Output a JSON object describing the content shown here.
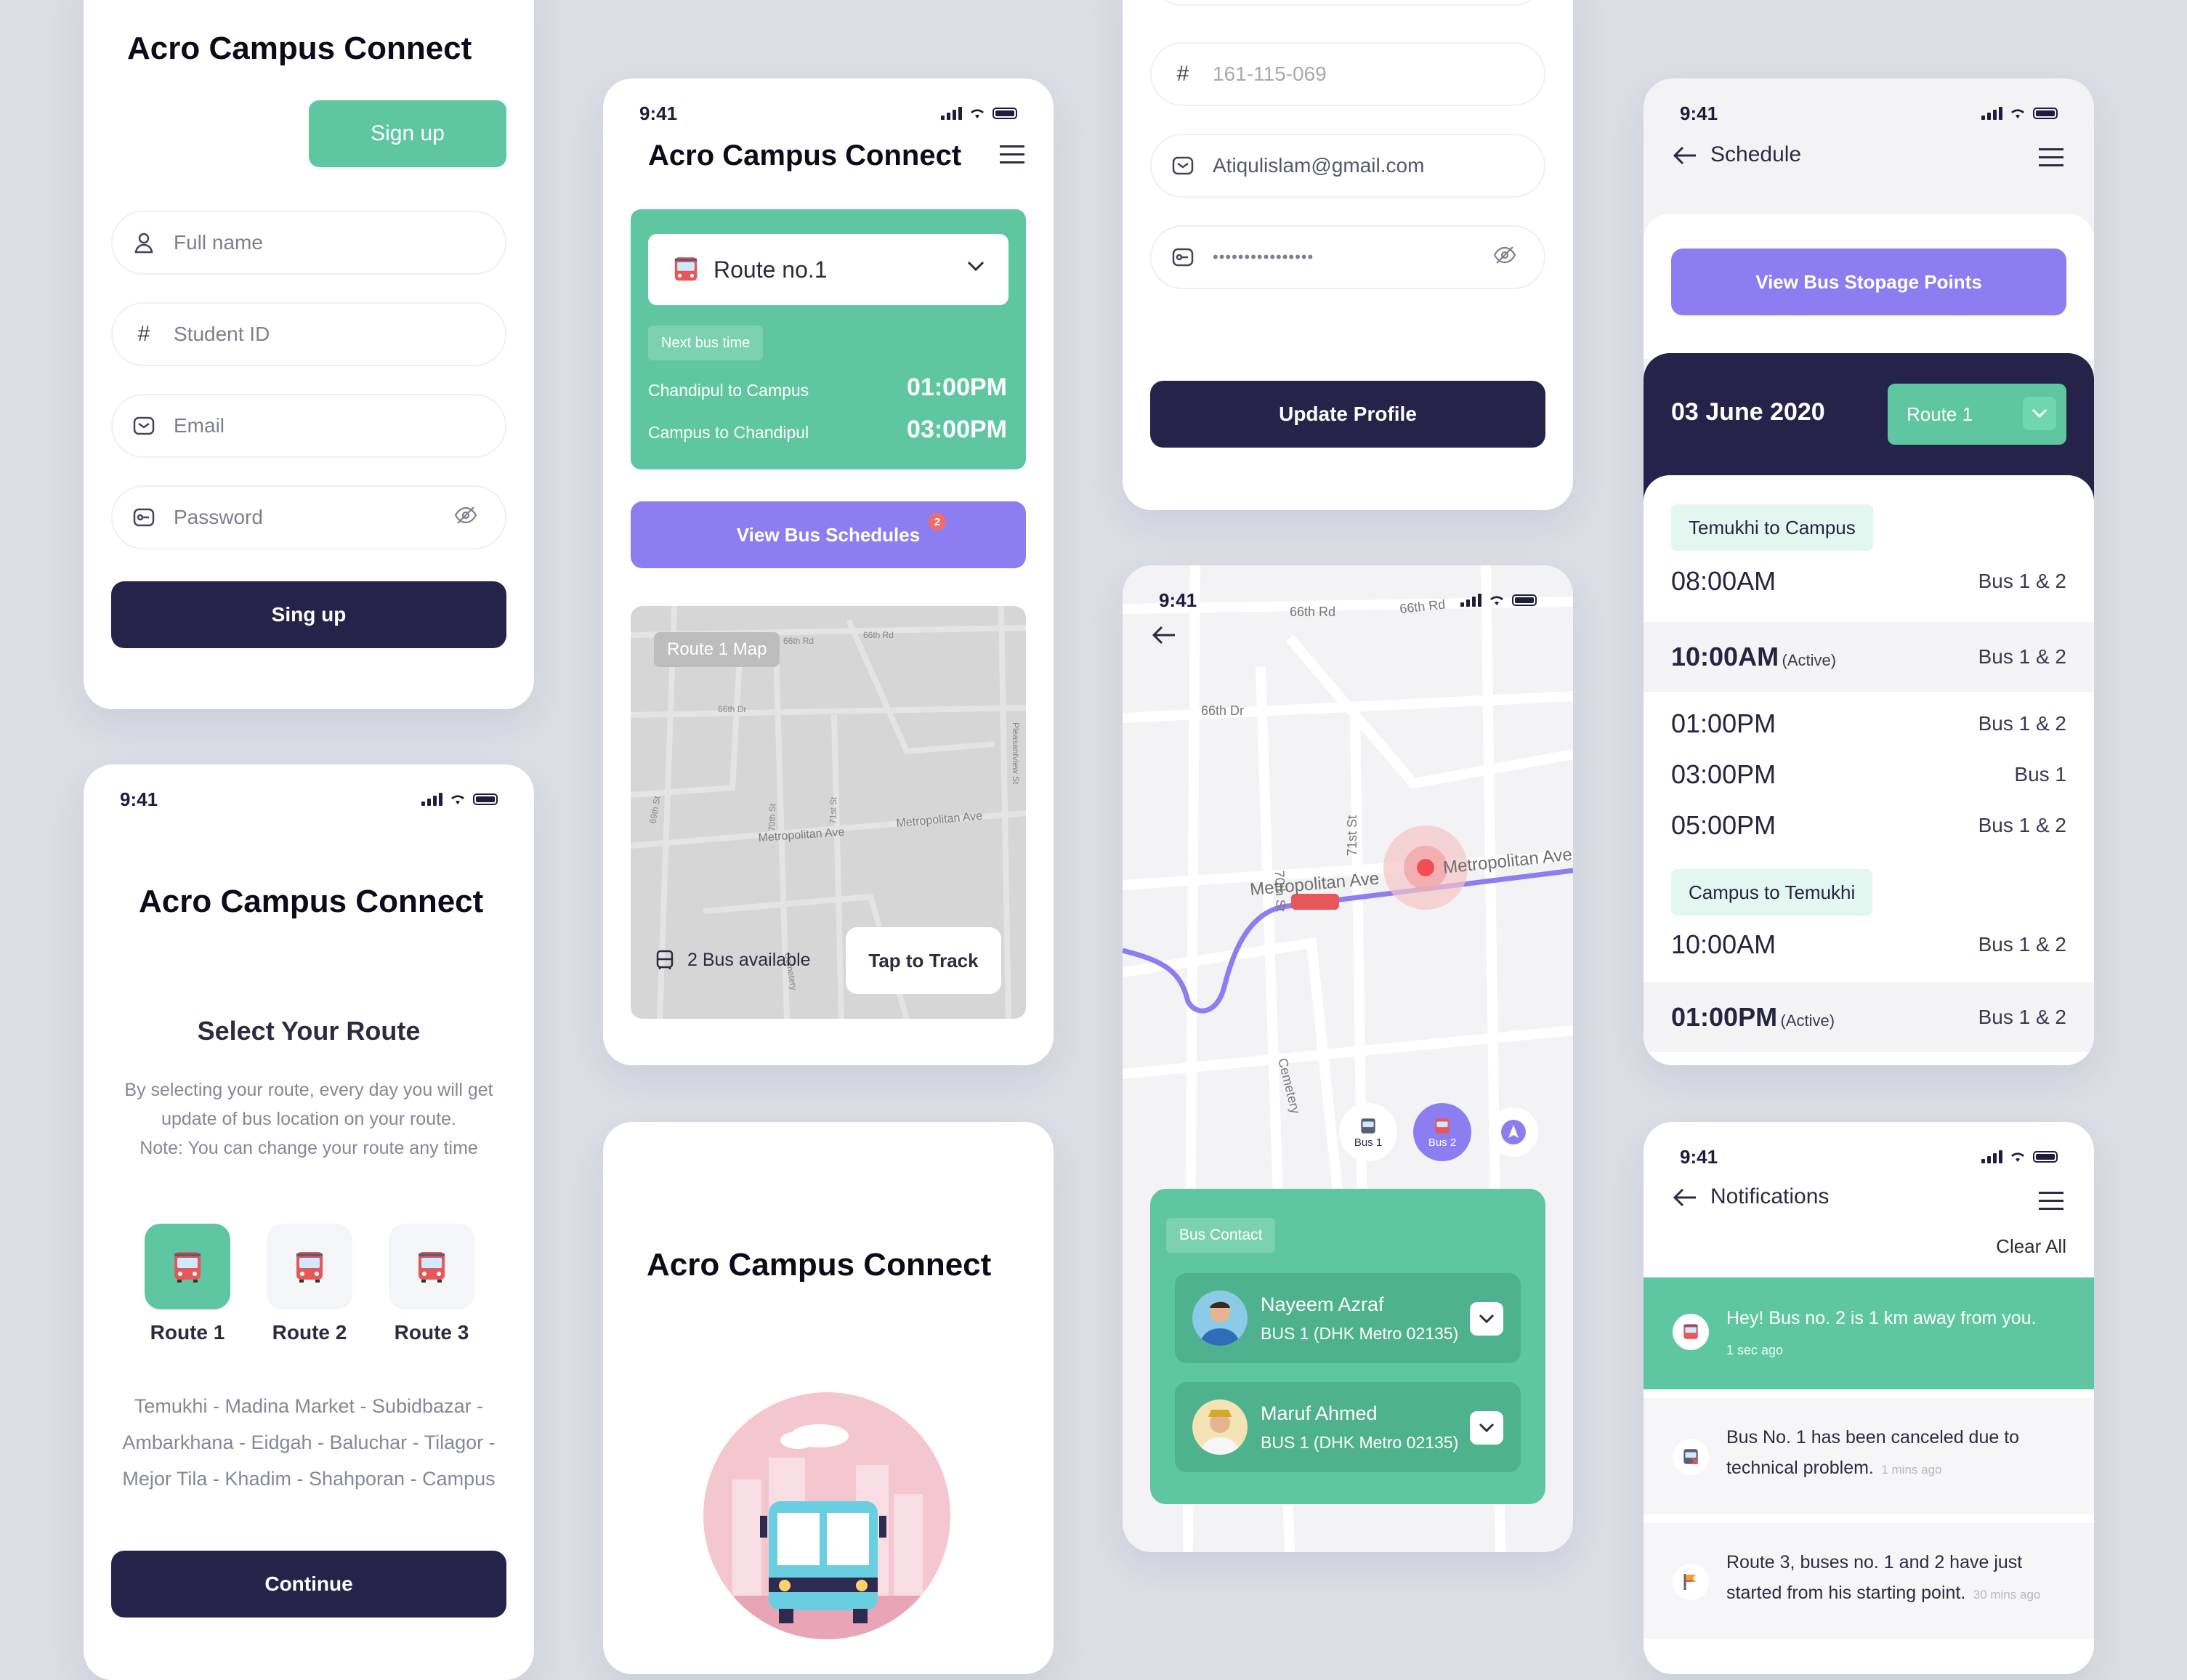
{
  "brand_name": "Acro Campus Connect",
  "status_time": "9:41",
  "signup": {
    "signup_tab": "Sign up",
    "fields": [
      {
        "icon": "user-icon",
        "placeholder": "Full name"
      },
      {
        "icon": "hash-icon",
        "placeholder": "Student ID"
      },
      {
        "icon": "mail-icon",
        "placeholder": "Email"
      },
      {
        "icon": "lock-icon",
        "placeholder": "Password"
      }
    ],
    "submit_label": "Sing up"
  },
  "select_route": {
    "heading": "Select Your Route",
    "description_1": "By selecting your route, every day you will get",
    "description_2": "update of bus location on your route.",
    "description_3": "Note: You can change your route any time",
    "routes": [
      "Route 1",
      "Route 2",
      "Route 3"
    ],
    "stops_1": "Temukhi - Madina Market - Subidbazar -",
    "stops_2": "Ambarkhana - Eidgah - Baluchar - Tilagor -",
    "stops_3": "Mejor Tila - Khadim - Shahporan - Campus",
    "continue_label": "Continue"
  },
  "home": {
    "route_select": "Route no.1",
    "next_bus_label": "Next bus time",
    "trips": [
      {
        "name": "Chandipul to Campus",
        "time": "01:00PM"
      },
      {
        "name": "Campus to Chandipul",
        "time": "03:00PM"
      }
    ],
    "schedules_button": "View Bus Schedules",
    "schedules_badge": "2",
    "map_label": "Route 1 Map",
    "map_streets": [
      "66th Rd",
      "66th Rd",
      "66th Dr",
      "69th St",
      "70th St",
      "71st St",
      "Metropolitan Ave",
      "Metropolitan Ave",
      "Pleasantview St",
      "Cemetery"
    ],
    "bus_available": "2 Bus available",
    "track_button": "Tap to Track"
  },
  "profile": {
    "student_id": "161-115-069",
    "email": "Atiqulislam@gmail.com",
    "password_mask": "••••••••••••••••",
    "update_button": "Update Profile"
  },
  "tracking": {
    "streets": [
      "66th Rd",
      "66th Rd",
      "66th Dr",
      "70th St",
      "71st St",
      "Metropolitan Ave",
      "Metropolitan Ave",
      "Cemetery"
    ],
    "bus_chips": [
      "Bus 1",
      "Bus 2"
    ],
    "contact_label": "Bus Contact",
    "contacts": [
      {
        "name": "Nayeem Azraf",
        "bus": "BUS 1 (DHK Metro 02135)"
      },
      {
        "name": "Maruf Ahmed",
        "bus": "BUS 1 (DHK Metro 02135)"
      }
    ]
  },
  "schedule": {
    "title": "Schedule",
    "stoppage_button": "View Bus Stopage Points",
    "date": "03 June 2020",
    "route_select": "Route 1",
    "sections": [
      {
        "label": "Temukhi to Campus",
        "rows": [
          {
            "time": "08:00AM",
            "active": "",
            "bus": "Bus 1 & 2"
          },
          {
            "time": "10:00AM",
            "active": "(Active)",
            "bus": "Bus 1 & 2"
          },
          {
            "time": "01:00PM",
            "active": "",
            "bus": "Bus 1 & 2"
          },
          {
            "time": "03:00PM",
            "active": "",
            "bus": "Bus 1"
          },
          {
            "time": "05:00PM",
            "active": "",
            "bus": "Bus 1 & 2"
          }
        ]
      },
      {
        "label": "Campus to Temukhi",
        "rows": [
          {
            "time": "10:00AM",
            "active": "",
            "bus": "Bus 1 & 2"
          },
          {
            "time": "01:00PM",
            "active": "(Active)",
            "bus": "Bus 1 & 2"
          }
        ]
      }
    ]
  },
  "notifications": {
    "title": "Notifications",
    "clear_all": "Clear All",
    "items": [
      {
        "line1": "Hey! Bus no. 2 is 1 km away from you.",
        "line2": "",
        "ago": "1 sec ago"
      },
      {
        "line1": "Bus No. 1 has been canceled due to",
        "line2": "technical problem.",
        "ago": "1 mins ago"
      },
      {
        "line1": "Route 3, buses no. 1 and 2 have just",
        "line2": "started from his starting point.",
        "ago": "30 mins ago"
      }
    ]
  },
  "colors": {
    "green": "#5ec7a1",
    "purple": "#8c7ef0",
    "navy": "#26234b",
    "background": "#dcdee6"
  }
}
